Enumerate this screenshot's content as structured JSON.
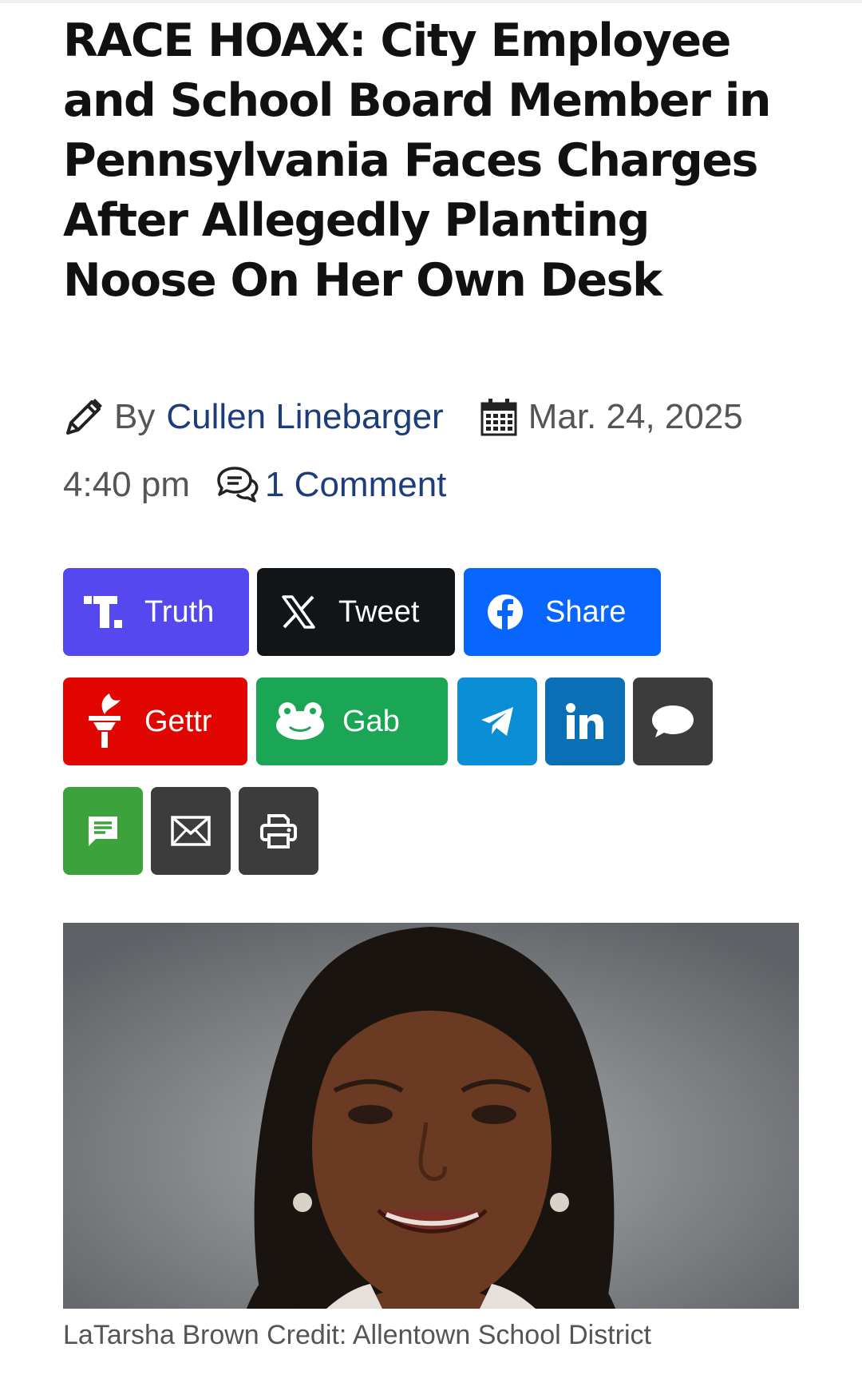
{
  "article": {
    "title": "RACE HOAX: City Employee and School Board Member in Pennsylvania Faces Charges After Allegedly Planting Noose On Her Own Desk",
    "by_label": "By",
    "author": "Cullen Linebarger",
    "date": "Mar. 24, 2025",
    "time": "4:40 pm",
    "comments": "1 Comment"
  },
  "share": {
    "truth": {
      "label": "Truth",
      "color": "#5448ee"
    },
    "tweet": {
      "label": "Tweet",
      "color": "#111518"
    },
    "facebook": {
      "label": "Share",
      "color": "#0866ff"
    },
    "gettr": {
      "label": "Gettr",
      "color": "#e10600"
    },
    "gab": {
      "label": "Gab",
      "color": "#1aa655"
    },
    "telegram": {
      "color": "#0a8fd6"
    },
    "linkedin": {
      "color": "#0a6fb5"
    },
    "comment": {
      "color": "#3c3c3c"
    },
    "sms": {
      "color": "#3ca33c"
    },
    "email": {
      "color": "#3c3c3c"
    },
    "print": {
      "color": "#3c3c3c"
    }
  },
  "image": {
    "caption": "LaTarsha Brown Credit: Allentown School District"
  }
}
